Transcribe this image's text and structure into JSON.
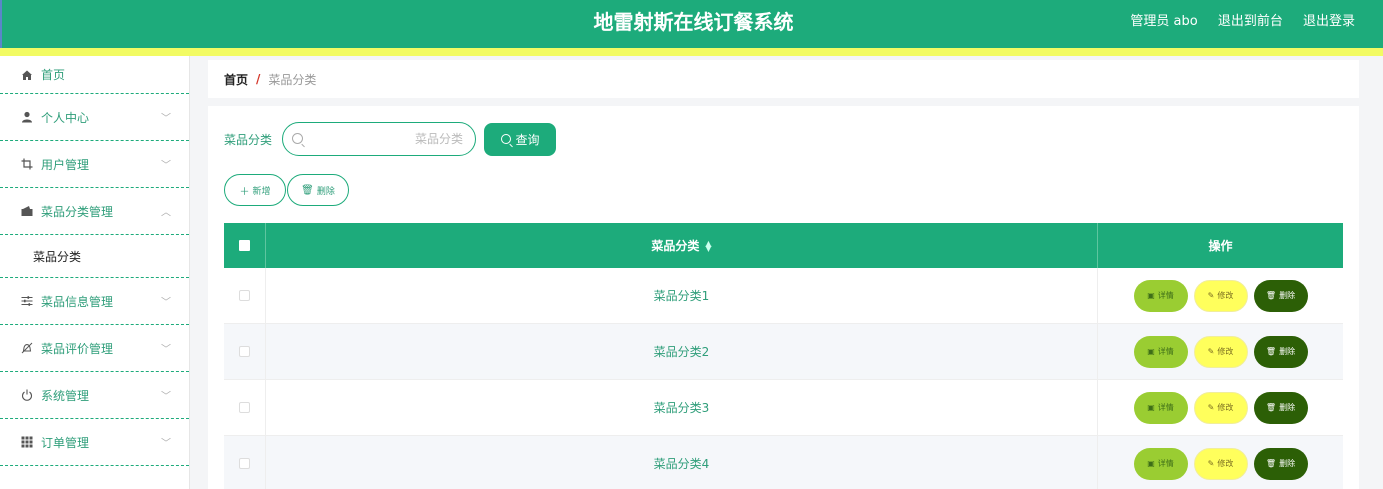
{
  "header": {
    "title": "地雷射斯在线订餐系统",
    "user": "管理员 abo",
    "to_front": "退出到前台",
    "logout": "退出登录"
  },
  "sidebar": {
    "items": [
      {
        "label": "首页",
        "icon": "home-icon"
      },
      {
        "label": "个人中心",
        "icon": "user-icon"
      },
      {
        "label": "用户管理",
        "icon": "crop-icon"
      },
      {
        "label": "菜品分类管理",
        "icon": "wallet-icon"
      },
      {
        "label": "菜品信息管理",
        "icon": "sliders-icon"
      },
      {
        "label": "菜品评价管理",
        "icon": "bell-off-icon"
      },
      {
        "label": "系统管理",
        "icon": "power-icon"
      },
      {
        "label": "订单管理",
        "icon": "grid-icon"
      }
    ],
    "submenu_label": "菜品分类"
  },
  "breadcrumb": {
    "home": "首页",
    "separator": "/",
    "current": "菜品分类"
  },
  "search": {
    "label": "菜品分类",
    "placeholder": "菜品分类",
    "button": "查询"
  },
  "actions": {
    "add": "新增",
    "delete": "删除"
  },
  "table": {
    "col_name": "菜品分类",
    "col_ops": "操作",
    "rows": [
      {
        "name": "菜品分类1"
      },
      {
        "name": "菜品分类2"
      },
      {
        "name": "菜品分类3"
      },
      {
        "name": "菜品分类4"
      }
    ],
    "op_detail": "详情",
    "op_edit": "修改",
    "op_delete": "删除"
  },
  "colors": {
    "primary": "#1dab7b",
    "accent_bar": "#f2fb63",
    "detail_btn": "#9acd32",
    "edit_btn": "#ffff5c",
    "delete_btn": "#2c5f06"
  }
}
